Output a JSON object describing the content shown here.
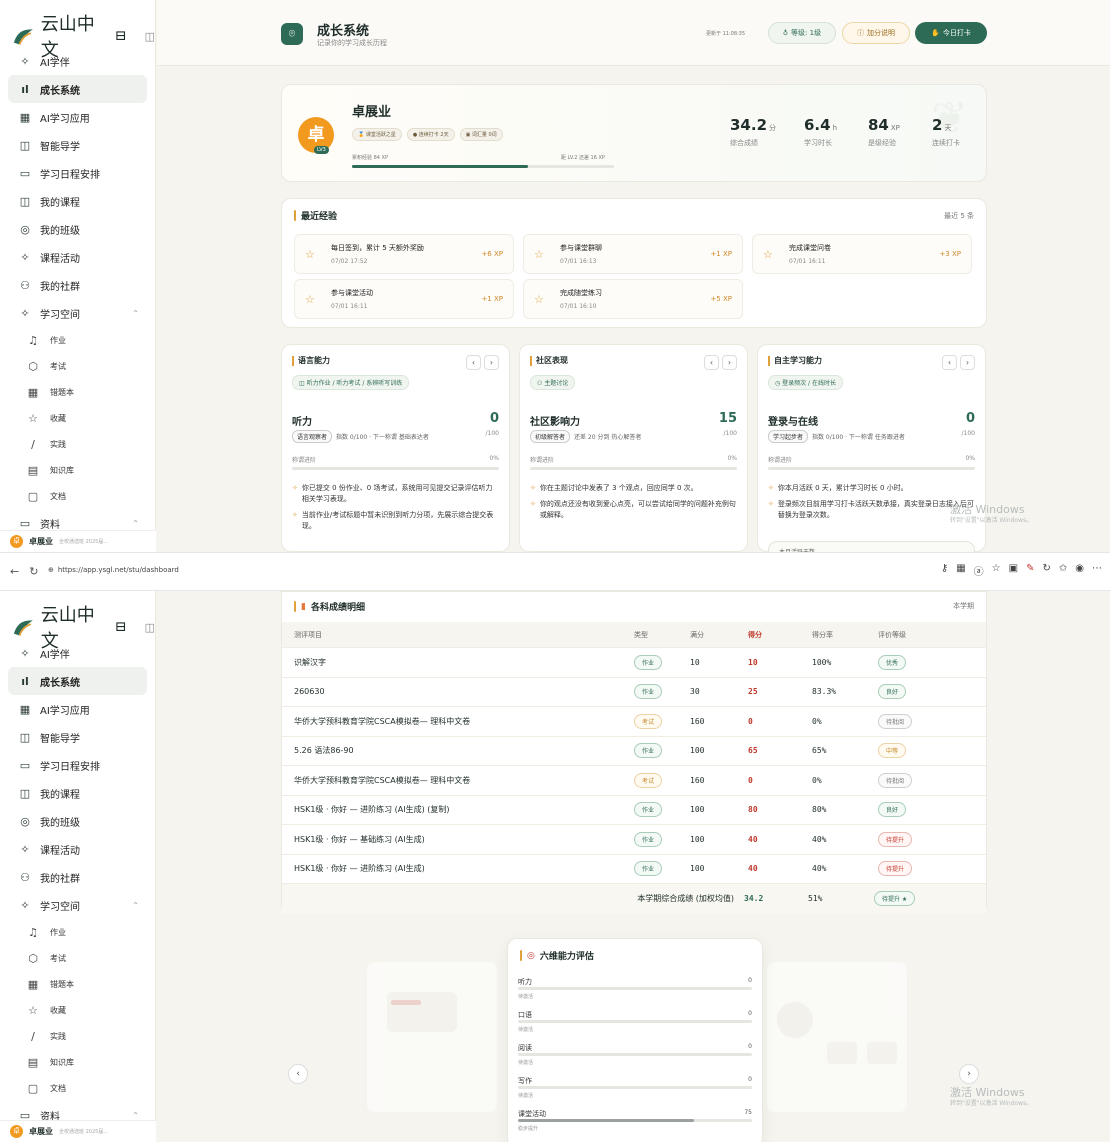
{
  "app": {
    "logo_text": "云山中文",
    "dock_label": "◫"
  },
  "sidebar": {
    "items": [
      {
        "label": "AI学伴",
        "icon": "✧"
      },
      {
        "label": "成长系统",
        "icon": "ıl",
        "active": true
      },
      {
        "label": "AI学习应用",
        "icon": "▦"
      },
      {
        "label": "智能导学",
        "icon": "◫"
      },
      {
        "label": "学习日程安排",
        "icon": "▭"
      },
      {
        "label": "我的课程",
        "icon": "◫"
      },
      {
        "label": "我的班级",
        "icon": "◎"
      },
      {
        "label": "课程活动",
        "icon": "✧"
      },
      {
        "label": "我的社群",
        "icon": "⚇"
      },
      {
        "label": "学习空间",
        "icon": "✧",
        "expand": "⌃"
      }
    ],
    "subitems": [
      {
        "label": "作业",
        "icon": "♫"
      },
      {
        "label": "考试",
        "icon": "⬡"
      },
      {
        "label": "错题本",
        "icon": "▦"
      },
      {
        "label": "收藏",
        "icon": "☆"
      },
      {
        "label": "实践",
        "icon": "∕"
      },
      {
        "label": "知识库",
        "icon": "▤"
      },
      {
        "label": "文档",
        "icon": "▢"
      }
    ],
    "last_item": {
      "label": "资料",
      "icon": "▭",
      "expand": "⌃"
    },
    "user": {
      "initial": "卓",
      "name": "卓展业",
      "sub": "全校通选班 2025届..."
    }
  },
  "header": {
    "title": "成长系统",
    "subtitle": "记录你的学习成长历程",
    "updated": "更新于 11:08:35",
    "level_btn": "等级: 1级",
    "help_btn": "加分说明",
    "checkin_btn": "今日打卡"
  },
  "profile": {
    "avatar": "卓",
    "level_tag": "LV3",
    "name": "卓展业",
    "badges": [
      "课堂活跃之星",
      "连续打卡 2天",
      "词汇量 0词"
    ],
    "xp_current": "累积经验 84 XP",
    "xp_next": "距 LV.2 还差 16 XP",
    "xp_progress": 0.67,
    "stats": [
      {
        "value": "34.2",
        "unit": "分",
        "label": "综合成绩"
      },
      {
        "value": "6.4",
        "unit": "h",
        "label": "学习时长"
      },
      {
        "value": "84",
        "unit": "XP",
        "label": "是级经验"
      },
      {
        "value": "2",
        "unit": "天",
        "label": "连续打卡"
      }
    ]
  },
  "recent_xp": {
    "title": "最近经验",
    "count_label": "最近 5 条",
    "items": [
      {
        "title": "每日签到，累计 5 天额外奖励",
        "date": "07/02 17:52",
        "xp": "+6 XP"
      },
      {
        "title": "参与课堂群聊",
        "date": "07/01 16:13",
        "xp": "+1 XP"
      },
      {
        "title": "完成课堂问卷",
        "date": "07/01 16:11",
        "xp": "+3 XP"
      },
      {
        "title": "参与课堂活动",
        "date": "07/01 16:11",
        "xp": "+1 XP"
      },
      {
        "title": "完成随堂练习",
        "date": "07/01 16:10",
        "xp": "+5 XP"
      }
    ]
  },
  "abilities": [
    {
      "title": "语言能力",
      "tag": "◫ 听力作业 / 听力考试 / 系辨听写训练",
      "name": "听力",
      "score": "0",
      "max": "/100",
      "level": "语言观察者",
      "level_desc": "指数 0/100 · 下一称谓 基础表达者",
      "prog_label": "称谓进阶",
      "prog_pct": "0%",
      "progress": 0,
      "tips": [
        "你已提交 0 份作业、0 场考试，系统用可见提交记录评估听力相关学习表现。",
        "当前作业/考试标题中暂未识别到听力分项，先展示综合提交表现。"
      ]
    },
    {
      "title": "社区表现",
      "tag": "⚇ 主题讨论",
      "name": "社区影响力",
      "score": "15",
      "max": "/100",
      "level": "初级解答者",
      "level_desc": "还差 20 分到 热心解答者",
      "prog_label": "称谓进阶",
      "prog_pct": "0%",
      "progress": 0,
      "tips": [
        "你在主题讨论中发表了 3 个观点，回应同学 0 次。",
        "你的观点还没有收到爱心点亮，可以尝试给同学的问题补充例句或解释。"
      ]
    },
    {
      "title": "自主学习能力",
      "tag": "◷ 登录频次 / 在线时长",
      "name": "登录与在线",
      "score": "0",
      "max": "/100",
      "level": "学习起步者",
      "level_desc": "指数 0/100 · 下一称谓 任务跟进者",
      "prog_label": "称谓进阶",
      "prog_pct": "0%",
      "progress": 0,
      "tips": [
        "你本月活跃 0 天，累计学习时长 0 小时。",
        "登录频次目前用学习打卡活跃天数承接，真实登录日志接入后可替换为登录次数。"
      ],
      "bottom": "本月活跃天数"
    }
  ],
  "windows_watermark": {
    "line1": "激活 Windows",
    "line2": "转到\"设置\"以激活 Windows。"
  },
  "browser": {
    "url": "https://app.ysgl.net/stu/dashboard"
  },
  "grades": {
    "title": "各科成绩明细",
    "period": "本学期",
    "columns": [
      "测评项目",
      "类型",
      "满分",
      "得分",
      "得分率",
      "评价等级"
    ],
    "rows": [
      {
        "name": "识解汉字",
        "type": "作业",
        "tk": "hw",
        "full": "10",
        "score": "10",
        "rate": "100%",
        "grade": "优秀",
        "gk": "ok"
      },
      {
        "name": "260630",
        "type": "作业",
        "tk": "hw",
        "full": "30",
        "score": "25",
        "rate": "83.3%",
        "grade": "良好",
        "gk": "ok"
      },
      {
        "name": "华侨大学预科教育学院CSCA模拟卷— 理科中文卷",
        "type": "考试",
        "tk": "ex",
        "full": "160",
        "score": "0",
        "rate": "0%",
        "grade": "待批阅",
        "gk": "wait"
      },
      {
        "name": "5.26 语法86-90",
        "type": "作业",
        "tk": "hw",
        "full": "100",
        "score": "65",
        "rate": "65%",
        "grade": "中等",
        "gk": "mid"
      },
      {
        "name": "华侨大学预科教育学院CSCA模拟卷— 理科中文卷",
        "type": "考试",
        "tk": "ex",
        "full": "160",
        "score": "0",
        "rate": "0%",
        "grade": "待批阅",
        "gk": "wait"
      },
      {
        "name": "HSK1级 · 你好 — 进阶练习 (AI生成) (复制)",
        "type": "作业",
        "tk": "hw",
        "full": "100",
        "score": "80",
        "rate": "80%",
        "grade": "良好",
        "gk": "ok"
      },
      {
        "name": "HSK1级 · 你好 — 基础练习 (AI生成)",
        "type": "作业",
        "tk": "hw",
        "full": "100",
        "score": "40",
        "rate": "40%",
        "grade": "待提升",
        "gk": "up"
      },
      {
        "name": "HSK1级 · 你好 — 进阶练习 (AI生成)",
        "type": "作业",
        "tk": "hw",
        "full": "100",
        "score": "40",
        "rate": "40%",
        "grade": "待提升",
        "gk": "up"
      }
    ],
    "total": {
      "label": "本学期综合成绩 (加权均值)",
      "score": "34.2",
      "rate": "51%",
      "grade": "待提升 ★"
    }
  },
  "six_dim": {
    "title": "六维能力评估",
    "rows": [
      {
        "name": "听力",
        "value": "0",
        "sub": "待激活",
        "level": 0
      },
      {
        "name": "口语",
        "value": "0",
        "sub": "待激活",
        "level": 0
      },
      {
        "name": "阅读",
        "value": "0",
        "sub": "待激活",
        "level": 0
      },
      {
        "name": "写作",
        "value": "0",
        "sub": "待激活",
        "level": 0
      },
      {
        "name": "课堂活动",
        "value": "75",
        "sub": "稳步提升",
        "level": 0.75
      }
    ]
  },
  "colors": {
    "accent": "#2e6b57",
    "gold": "#e0a13a",
    "danger": "#c0392b"
  }
}
